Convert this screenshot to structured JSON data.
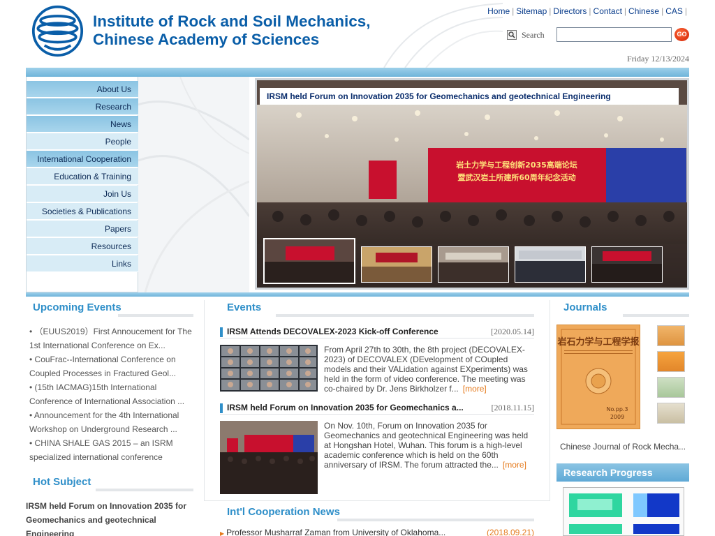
{
  "header": {
    "logo_line1": "Institute of Rock and Soil Mechanics,",
    "logo_line2": "Chinese Academy of Sciences",
    "topnav": [
      "Home",
      "Sitemap",
      "Directors",
      "Contact",
      "Chinese",
      "CAS"
    ],
    "search_label": "Search",
    "search_value": "",
    "go_label": "GO",
    "date": "Friday 12/13/2024"
  },
  "sidebar": {
    "items": [
      {
        "label": "About Us"
      },
      {
        "label": "Research"
      },
      {
        "label": "News"
      },
      {
        "label": "People"
      },
      {
        "label": "International Cooperation"
      },
      {
        "label": "Education & Training"
      },
      {
        "label": "Join Us"
      },
      {
        "label": "Societies & Publications"
      },
      {
        "label": "Papers"
      },
      {
        "label": "Resources"
      },
      {
        "label": "Links"
      }
    ]
  },
  "slider": {
    "caption": "IRSM held Forum on Innovation 2035 for Geomechanics and geotechnical Engineering",
    "banner_text_line1": "岩土力学与工程创新2035高端论坛",
    "banner_text_line2": "暨武汉岩土所建所60周年纪念活动",
    "thumb_count": 5
  },
  "upcoming_events": {
    "title": "Upcoming Events",
    "items": [
      "• （EUUS2019）First Annoucement for The 1st International Conference on Ex...",
      "• CouFrac--International Conference on Coupled Processes in Fractured Geol...",
      "• (15th IACMAG)15th International Conference of International Association ...",
      "• Announcement for the 4th International Workshop on Underground Research ...",
      "• CHINA SHALE GAS 2015 – an ISRM specialized international conference"
    ]
  },
  "hot_subject": {
    "title": "Hot Subject",
    "item": "IRSM held Forum on Innovation 2035 for Geomechanics and geotechnical Engineering"
  },
  "events": {
    "title": "Events",
    "items": [
      {
        "title": "IRSM Attends DECOVALEX-2023 Kick-off Conference",
        "date": "[2020.05.14]",
        "summary": "From April 27th to 30th, the 8th project (DECOVALEX-2023) of DECOVALEX (DEvelopment of COupled models and their VALidation against EXperiments) was held in the form of video conference. The meeting was co-chaired by Dr. Jens Birkholzer f...",
        "more": "[more]"
      },
      {
        "title": "IRSM held Forum on Innovation 2035 for Geomechanics a...",
        "date": "[2018.11.15]",
        "summary": "On Nov. 10th, Forum on Innovation 2035 for Geomechanics and geotechnical Engineering was held at Hongshan Hotel, Wuhan. This forum is a high-level academic conference which is held on the 60th anniversary of IRSM. The forum attracted the...",
        "more": "[more]"
      }
    ]
  },
  "intl_coop": {
    "title": "Int'l Cooperation News",
    "item": "Professor Musharraf Zaman from University of Oklahoma...",
    "date": "(2018.09.21)"
  },
  "journals": {
    "title": "Journals",
    "cover_title": "岩石力学与工程学报",
    "cover_issue": "No.pp.3",
    "cover_year": "2009",
    "name": "Chinese Journal of Rock Mecha..."
  },
  "research_progress": {
    "title": "Research Progress"
  },
  "colors": {
    "brand_blue": "#0a5ea8",
    "section_blue": "#2f8fc9",
    "menu_dark": "#8bc4e3",
    "menu_light": "#d8ecf6",
    "accent_orange": "#e57a1c"
  }
}
